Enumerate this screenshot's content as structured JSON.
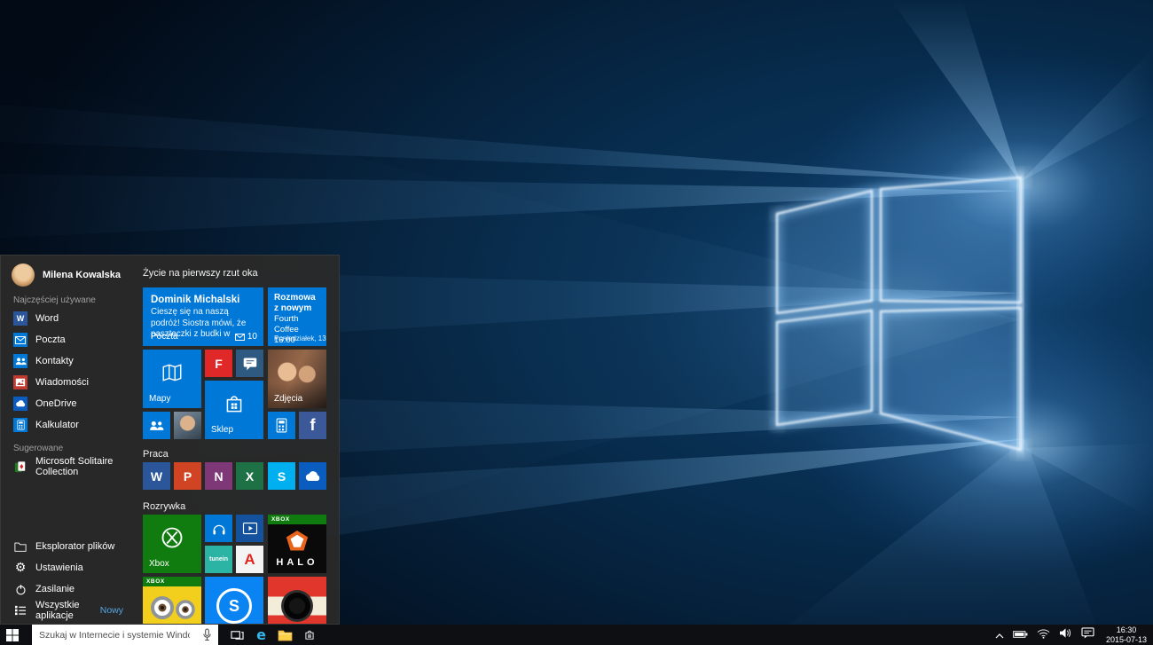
{
  "colors": {
    "accent": "#0078d7",
    "menu_background": "#292929",
    "taskbar_background": "#0e0f12",
    "xbox_green": "#107c10"
  },
  "start_menu": {
    "user": {
      "name": "Milena Kowalska"
    },
    "most_used": {
      "label": "Najczęściej używane",
      "items": [
        {
          "label": "Word",
          "icon": "word-icon"
        },
        {
          "label": "Poczta",
          "icon": "mail-icon"
        },
        {
          "label": "Kontakty",
          "icon": "people-icon"
        },
        {
          "label": "Wiadomości",
          "icon": "news-icon"
        },
        {
          "label": "OneDrive",
          "icon": "onedrive-cloud-icon"
        },
        {
          "label": "Kalkulator",
          "icon": "calculator-icon"
        }
      ]
    },
    "suggested": {
      "label": "Sugerowane",
      "items": [
        {
          "label": "Microsoft Solitaire Collection",
          "icon": "solitaire-icon"
        }
      ]
    },
    "footer": {
      "items": [
        {
          "label": "Eksplorator plików",
          "icon": "folder-icon"
        },
        {
          "label": "Ustawienia",
          "icon": "gear-icon"
        },
        {
          "label": "Zasilanie",
          "icon": "power-icon"
        },
        {
          "label": "Wszystkie aplikacje",
          "icon": "all-apps-icon"
        }
      ],
      "new_badge": "Nowy"
    },
    "groups": {
      "glance": "Życie na pierwszy rzut oka",
      "work": "Praca",
      "fun": "Rozrywka"
    },
    "tiles": {
      "mail": {
        "sender": "Dominik Michalski",
        "preview": "Cieszę się na naszą podróż! Siostra mówi, że paszteczki z budki w",
        "app": "Poczta",
        "badge": "10"
      },
      "calendar": {
        "title": "Rozmowa z nowym",
        "location": "Fourth Coffee",
        "time": "16:00",
        "footer": "Poniedziałek, 13"
      },
      "maps": {
        "label": "Mapy"
      },
      "photos": {
        "label": "Zdjęcia"
      },
      "store": {
        "label": "Sklep"
      },
      "xbox": {
        "label": "Xbox"
      },
      "halo": {
        "label": "HALO",
        "banner": "XBOX"
      },
      "minions": {
        "banner": "XBOX"
      },
      "tunein": {
        "label": "tunein"
      }
    }
  },
  "icons": {
    "word_letter": "W",
    "powerpoint_letter": "P",
    "onenote_letter": "N",
    "excel_letter": "X",
    "skype_letter": "S",
    "facebook_letter": "f",
    "flipboard_letter": "F",
    "adobe_letter": "A",
    "shazam_letter": "S",
    "edge_letter": "e"
  },
  "taskbar": {
    "search": {
      "placeholder": "Szukaj w Internecie i systemie Windows"
    },
    "clock": {
      "time": "16:30",
      "date": "2015-07-13"
    }
  }
}
